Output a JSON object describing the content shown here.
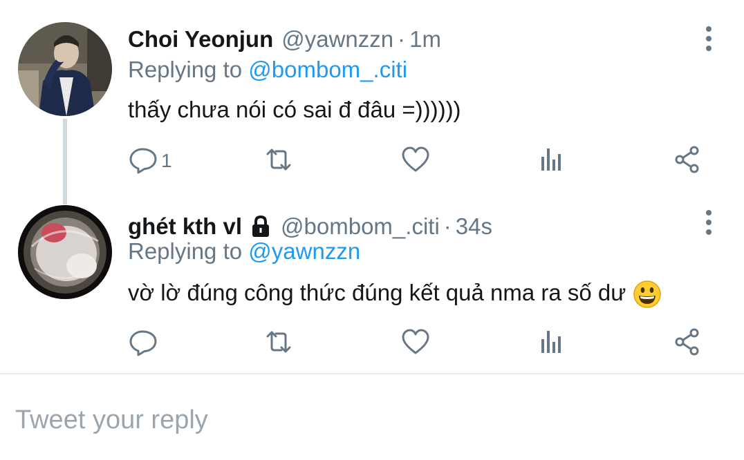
{
  "tweets": [
    {
      "name": "Choi Yeonjun",
      "handle": "@yawnzzn",
      "time": "1m",
      "replying_prefix": "Replying to",
      "replying_to": "@bombom_.citi",
      "text": "thấy chưa nói có sai đ đâu =))))))",
      "reply_count": "1",
      "avatar": "person-photo"
    },
    {
      "name": "ghét kth vl",
      "locked": true,
      "handle": "@bombom_.citi",
      "time": "34s",
      "replying_prefix": "Replying to",
      "replying_to": "@yawnzzn",
      "text": "vờ lờ đúng công thức đúng kết quả nma ra số dư",
      "emoji": "grinning-face",
      "reply_count": "",
      "avatar": "hamster-photo"
    }
  ],
  "reply_box": {
    "placeholder": "Tweet your reply"
  },
  "icons": [
    "reply-icon",
    "retweet-icon",
    "like-icon",
    "analytics-icon",
    "share-icon",
    "more-options-icon",
    "lock-icon"
  ],
  "colors": {
    "text": "#14171a",
    "muted": "#657786",
    "link": "#1d9bf0",
    "divider": "#e6ecf0",
    "thread_line": "#cfd9de"
  }
}
